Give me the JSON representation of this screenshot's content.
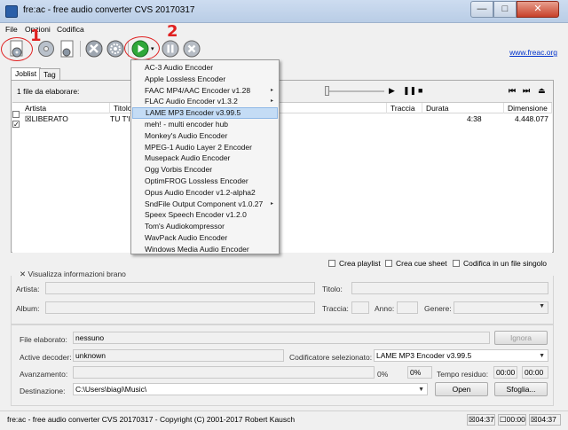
{
  "window": {
    "title": "fre:ac - free audio converter CVS 20170317",
    "min_icon": "—",
    "max_icon": "□",
    "close_icon": "✕"
  },
  "menu": [
    "File",
    "Opzioni",
    "Codifica"
  ],
  "annotations": {
    "one": "1",
    "two": "2"
  },
  "toolbar": {
    "website": "www.freac.org"
  },
  "tabs": [
    "Joblist",
    "Tag"
  ],
  "joblist": {
    "files_count": "1 file da elaborare:",
    "columns": [
      "Artista",
      "Titolo",
      "Traccia",
      "Durata",
      "Dimensione"
    ],
    "rows": [
      {
        "checked": "☒",
        "artista": "LIBERATO",
        "titolo": "TU T'I",
        "traccia": "",
        "durata": "4:38",
        "dimensione": "4.448.077"
      }
    ]
  },
  "encoder_menu": {
    "items": [
      {
        "label": "AC-3 Audio Encoder",
        "sub": ""
      },
      {
        "label": "Apple Lossless Encoder",
        "sub": ""
      },
      {
        "label": "FAAC MP4/AAC Encoder v1.28",
        "sub": "▸"
      },
      {
        "label": "FLAC Audio Encoder v1.3.2",
        "sub": "▸"
      },
      {
        "label": "LAME MP3 Encoder v3.99.5",
        "sub": ""
      },
      {
        "label": "meh! - multi encoder hub",
        "sub": ""
      },
      {
        "label": "Monkey's Audio Encoder",
        "sub": ""
      },
      {
        "label": "MPEG-1 Audio Layer 2 Encoder",
        "sub": ""
      },
      {
        "label": "Musepack Audio Encoder",
        "sub": ""
      },
      {
        "label": "Ogg Vorbis Encoder",
        "sub": ""
      },
      {
        "label": "OptimFROG Lossless Encoder",
        "sub": ""
      },
      {
        "label": "Opus Audio Encoder v1.2-alpha2",
        "sub": ""
      },
      {
        "label": "SndFile Output Component v1.0.27",
        "sub": "▸"
      },
      {
        "label": "Speex Speech Encoder v1.2.0",
        "sub": ""
      },
      {
        "label": "Tom's Audiokompressor",
        "sub": ""
      },
      {
        "label": "WavPack Audio Encoder",
        "sub": ""
      },
      {
        "label": "Windows Media Audio Encoder",
        "sub": ""
      }
    ],
    "selected_index": 4
  },
  "options": {
    "crea_playlist": "Crea playlist",
    "crea_cue": "Crea cue sheet",
    "codifica_singolo": "Codifica in un file singolo"
  },
  "info": {
    "toggle_mark": "✕",
    "toggle_label": "Visualizza informazioni brano",
    "artista": "Artista:",
    "titolo": "Titolo:",
    "album": "Album:",
    "traccia": "Traccia:",
    "anno": "Anno:",
    "genere": "Genere:"
  },
  "progress": {
    "file_label": "File elaborato:",
    "file_value": "nessuno",
    "ignora": "Ignora",
    "decoder_label": "Active decoder:",
    "decoder_value": "unknown",
    "encoder_label": "Codificatore selezionato:",
    "encoder_value": "LAME MP3 Encoder v3.99.5",
    "avanzamento_label": "Avanzamento:",
    "pct1": "0%",
    "pct2": "0%",
    "tempo_label": "Tempo residuo:",
    "time1": "00:00",
    "time2": "00:00",
    "dest_label": "Destinazione:",
    "dest_value": "C:\\Users\\biagi\\Music\\",
    "open": "Open",
    "sfoglia": "Sfoglia..."
  },
  "status": {
    "text": "fre:ac - free audio converter CVS 20170317 - Copyright (C) 2001-2017 Robert Kausch",
    "t1": "☒04:37",
    "t2": "☐00:00",
    "t3": "☒04:37"
  },
  "colors": {
    "accent": "#0078d7",
    "annotation_red": "#e02020",
    "link": "#0033cc",
    "play_green": "#2fa83a"
  }
}
